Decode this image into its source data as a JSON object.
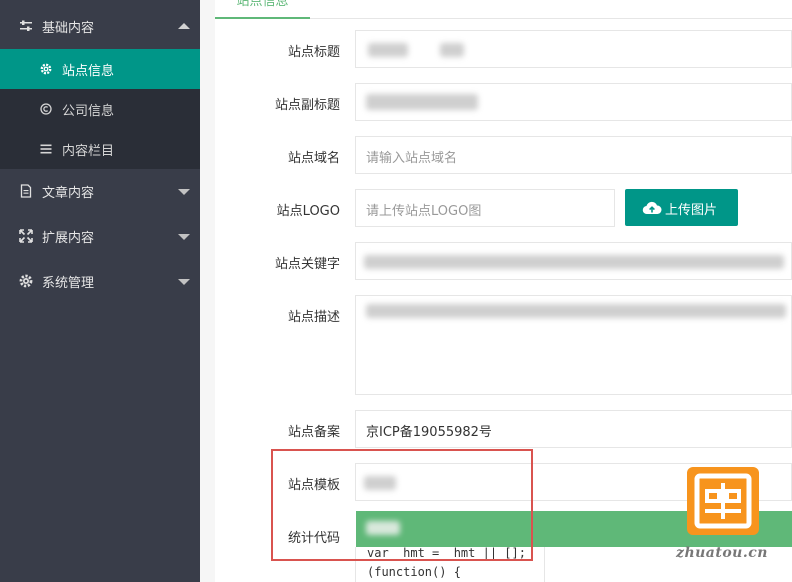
{
  "sidebar": {
    "groups": [
      {
        "label": "基础内容",
        "icon": "sliders-icon"
      },
      {
        "label": "文章内容",
        "icon": "document-icon"
      },
      {
        "label": "扩展内容",
        "icon": "expand-icon"
      },
      {
        "label": "系统管理",
        "icon": "gear-icon"
      }
    ],
    "subitems": [
      {
        "label": "站点信息",
        "icon": "gear-icon"
      },
      {
        "label": "公司信息",
        "icon": "copyright-icon"
      },
      {
        "label": "内容栏目",
        "icon": "list-icon"
      }
    ]
  },
  "tabs": {
    "active": "站点信息"
  },
  "form": {
    "title_label": "站点标题",
    "subtitle_label": "站点副标题",
    "domain_label": "站点域名",
    "domain_placeholder": "请输入站点域名",
    "logo_label": "站点LOGO",
    "logo_placeholder": "请上传站点LOGO图",
    "upload_button": "上传图片",
    "keywords_label": "站点关键字",
    "description_label": "站点描述",
    "icp_label": "站点备案",
    "icp_value": "京ICP备19055982号",
    "template_label": "站点模板",
    "stats_label": "统计代码",
    "stats_code_line1": "var _hmt = _hmt || [];",
    "stats_code_line2": "(function() {"
  },
  "watermark": {
    "text": "zhuatou.cn"
  },
  "colors": {
    "sidebar_bg": "#393d49",
    "submenu_bg": "#2a2e37",
    "active_bg": "#009688",
    "tab_accent": "#5FB878",
    "highlight_box": "#d9534f",
    "watermark_bg": "#f7941d"
  }
}
